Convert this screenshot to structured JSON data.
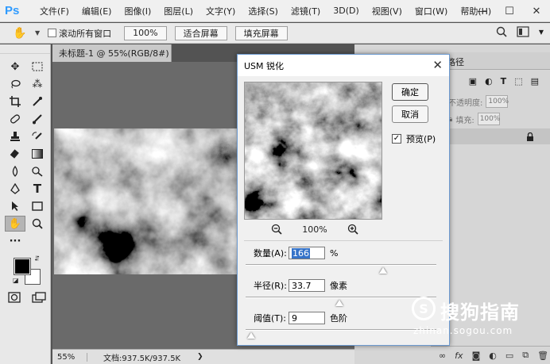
{
  "app": {
    "logo": "Ps"
  },
  "menu": [
    "文件(F)",
    "编辑(E)",
    "图像(I)",
    "图层(L)",
    "文字(Y)",
    "选择(S)",
    "滤镜(T)",
    "3D(D)",
    "视图(V)",
    "窗口(W)",
    "帮助(H)"
  ],
  "window_controls": {
    "minimize": "—",
    "maximize": "☐",
    "close": "✕"
  },
  "options_bar": {
    "scroll_all_label": "滚动所有窗口",
    "zoom_100": "100%",
    "fit_screen": "适合屏幕",
    "fill_screen": "填充屏幕"
  },
  "document": {
    "tab_title": "未标题-1 @ 55%(RGB/8#) *",
    "tab_close": "×",
    "status_zoom": "55%",
    "status_doc": "文档:937.5K/937.5K"
  },
  "panel": {
    "tab_partial": "路径",
    "opacity_label": "不透明度:",
    "opacity_value": "100%",
    "fill_label": "填充:",
    "fill_value": "100%"
  },
  "dialog": {
    "title": "USM 锐化",
    "ok": "确定",
    "cancel": "取消",
    "preview_label": "预览(P)",
    "preview_checked": true,
    "zoom": "100%",
    "amount_label": "数量(A):",
    "amount_value": "166",
    "amount_unit": "%",
    "amount_level": 0.72,
    "radius_label": "半径(R):",
    "radius_value": "33.7",
    "radius_unit": "像素",
    "radius_level": 0.49,
    "threshold_label": "阈值(T):",
    "threshold_value": "9",
    "threshold_unit": "色阶",
    "threshold_level": 0.03
  },
  "watermark": {
    "brand": "搜狗指南",
    "url": "zhinan.sogou.com"
  },
  "colors": {
    "accent": "#2f9bff",
    "dialog_border": "#6d9bd1",
    "selection": "#3573c9"
  }
}
